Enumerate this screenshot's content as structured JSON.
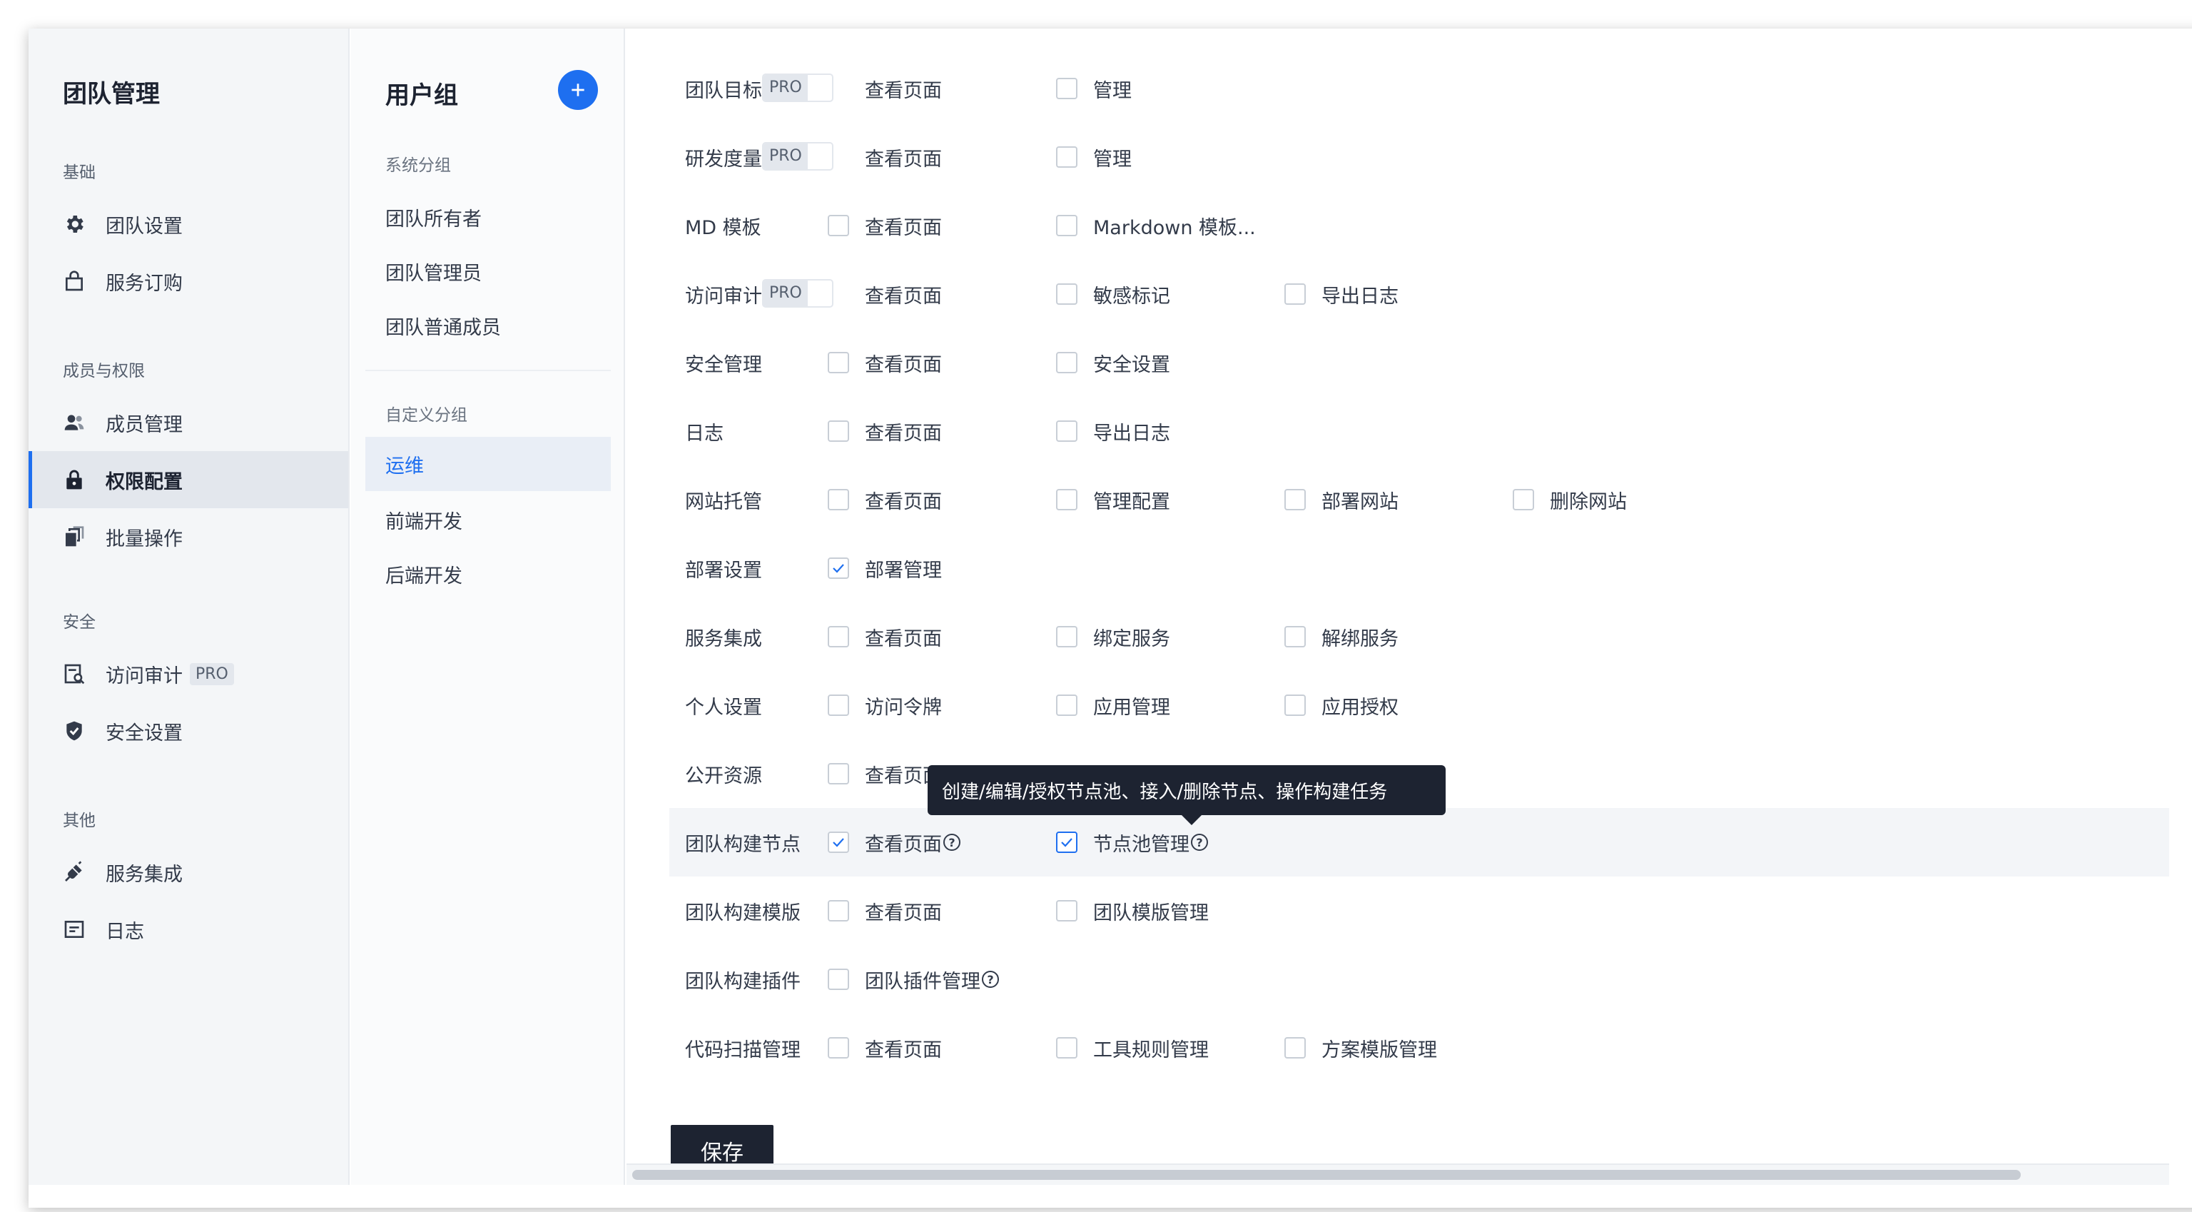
{
  "nav": {
    "title": "团队管理",
    "sections": [
      {
        "label": "基础",
        "items": [
          {
            "label": "团队设置",
            "icon": "gear-icon"
          },
          {
            "label": "服务订购",
            "icon": "bag-icon"
          }
        ]
      },
      {
        "label": "成员与权限",
        "items": [
          {
            "label": "成员管理",
            "icon": "members-icon"
          },
          {
            "label": "权限配置",
            "icon": "lock-icon",
            "active": true
          },
          {
            "label": "批量操作",
            "icon": "batch-icon"
          }
        ]
      },
      {
        "label": "安全",
        "items": [
          {
            "label": "访问审计",
            "icon": "audit-icon",
            "badge": "PRO"
          },
          {
            "label": "安全设置",
            "icon": "shield-icon"
          }
        ]
      },
      {
        "label": "其他",
        "items": [
          {
            "label": "服务集成",
            "icon": "plug-icon"
          },
          {
            "label": "日志",
            "icon": "log-icon"
          }
        ]
      }
    ]
  },
  "groups": {
    "title": "用户组",
    "system_label": "系统分组",
    "system_items": [
      "团队所有者",
      "团队管理员",
      "团队普通成员"
    ],
    "custom_label": "自定义分组",
    "custom_items": [
      "运维",
      "前端开发",
      "后端开发"
    ],
    "active": "运维"
  },
  "permissions": [
    {
      "name": "团队目标",
      "pro": "PRO",
      "options": [
        {
          "label": "查看页面",
          "checked": false,
          "pro_slot": true
        },
        {
          "label": "管理",
          "checked": false
        }
      ]
    },
    {
      "name": "研发度量",
      "pro": "PRO",
      "options": [
        {
          "label": "查看页面",
          "checked": false,
          "pro_slot": true
        },
        {
          "label": "管理",
          "checked": false
        }
      ]
    },
    {
      "name": "MD 模板",
      "options": [
        {
          "label": "查看页面",
          "checked": false
        },
        {
          "label": "Markdown 模板...",
          "checked": false
        }
      ]
    },
    {
      "name": "访问审计",
      "pro": "PRO",
      "options": [
        {
          "label": "查看页面",
          "checked": false,
          "pro_slot": true
        },
        {
          "label": "敏感标记",
          "checked": false
        },
        {
          "label": "导出日志",
          "checked": false
        }
      ]
    },
    {
      "name": "安全管理",
      "options": [
        {
          "label": "查看页面",
          "checked": false
        },
        {
          "label": "安全设置",
          "checked": false
        }
      ]
    },
    {
      "name": "日志",
      "options": [
        {
          "label": "查看页面",
          "checked": false
        },
        {
          "label": "导出日志",
          "checked": false
        }
      ]
    },
    {
      "name": "网站托管",
      "options": [
        {
          "label": "查看页面",
          "checked": false
        },
        {
          "label": "管理配置",
          "checked": false
        },
        {
          "label": "部署网站",
          "checked": false
        },
        {
          "label": "删除网站",
          "checked": false
        }
      ]
    },
    {
      "name": "部署设置",
      "options": [
        {
          "label": "部署管理",
          "checked": true
        }
      ]
    },
    {
      "name": "服务集成",
      "options": [
        {
          "label": "查看页面",
          "checked": false
        },
        {
          "label": "绑定服务",
          "checked": false
        },
        {
          "label": "解绑服务",
          "checked": false
        }
      ]
    },
    {
      "name": "个人设置",
      "options": [
        {
          "label": "访问令牌",
          "checked": false
        },
        {
          "label": "应用管理",
          "checked": false
        },
        {
          "label": "应用授权",
          "checked": false
        }
      ]
    },
    {
      "name": "公开资源",
      "options": [
        {
          "label": "查看页面",
          "checked": false
        }
      ]
    },
    {
      "name": "团队构建节点",
      "highlight": true,
      "options": [
        {
          "label": "查看页面",
          "checked": true,
          "help": true
        },
        {
          "label": "节点池管理",
          "checked": true,
          "help": true,
          "strong": true
        }
      ]
    },
    {
      "name": "团队构建模版",
      "options": [
        {
          "label": "查看页面",
          "checked": false
        },
        {
          "label": "团队模版管理",
          "checked": false
        }
      ]
    },
    {
      "name": "团队构建插件",
      "options": [
        {
          "label": "团队插件管理",
          "checked": false,
          "help": true
        }
      ]
    },
    {
      "name": "代码扫描管理",
      "options": [
        {
          "label": "查看页面",
          "checked": false
        },
        {
          "label": "工具规则管理",
          "checked": false
        },
        {
          "label": "方案模版管理",
          "checked": false
        }
      ]
    }
  ],
  "tooltip": "创建/编辑/授权节点池、接入/删除节点、操作构建任务",
  "save_label": "保存",
  "colors": {
    "accent": "#1e6ff0",
    "dark": "#1d2331",
    "nav_bg": "#f4f6f8"
  }
}
